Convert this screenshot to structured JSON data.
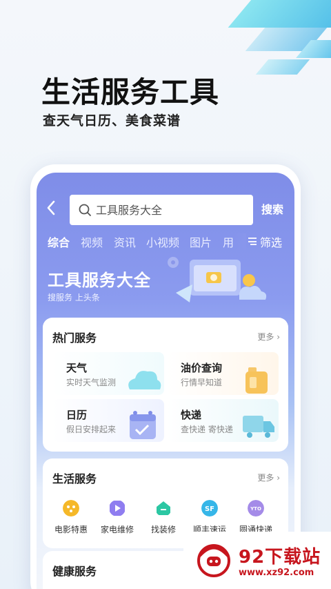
{
  "hero": {
    "title": "生活服务工具",
    "subtitle": "查天气日历、美食菜谱"
  },
  "topbar": {
    "back_icon": "chevron-left-icon",
    "search_placeholder": "工具服务大全",
    "search_button": "搜索"
  },
  "tabs": [
    {
      "label": "综合",
      "active": true
    },
    {
      "label": "视频",
      "active": false
    },
    {
      "label": "资讯",
      "active": false
    },
    {
      "label": "小视频",
      "active": false
    },
    {
      "label": "图片",
      "active": false
    },
    {
      "label": "用",
      "active": false
    }
  ],
  "filter": {
    "label": "筛选",
    "icon": "filter-icon"
  },
  "banner": {
    "title": "工具服务大全",
    "subtitle": "搜服务 上头条"
  },
  "hot_services": {
    "title": "热门服务",
    "more": "更多 ›",
    "items": [
      {
        "name": "天气",
        "desc": "实时天气监测",
        "icon": "cloud-icon"
      },
      {
        "name": "油价查询",
        "desc": "行情早知道",
        "icon": "oil-can-icon"
      },
      {
        "name": "日历",
        "desc": "假日安排起来",
        "icon": "calendar-icon"
      },
      {
        "name": "快递",
        "desc": "查快递 寄快递",
        "icon": "truck-icon"
      }
    ]
  },
  "life_services": {
    "title": "生活服务",
    "more": "更多 ›",
    "items": [
      {
        "label": "电影特惠",
        "icon": "movie-icon",
        "color": "#f5b829"
      },
      {
        "label": "家电维修",
        "icon": "appliance-icon",
        "color": "#8f7df0"
      },
      {
        "label": "找装修",
        "icon": "house-icon",
        "color": "#2cc7a3"
      },
      {
        "label": "顺丰速运",
        "icon": "sf-express-icon",
        "color": "#36b6e8"
      },
      {
        "label": "圆通快递",
        "icon": "yto-express-icon",
        "color": "#a48be8"
      }
    ]
  },
  "health_services": {
    "title": "健康服务"
  },
  "watermark": {
    "name": "92下载站",
    "url": "www.xz92.com"
  }
}
